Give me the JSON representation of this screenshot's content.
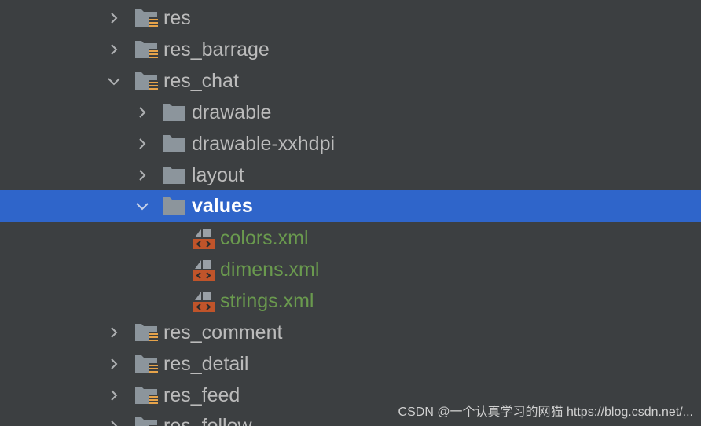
{
  "tree": {
    "items": [
      {
        "label": "res",
        "expanded": false,
        "type": "resource-folder"
      },
      {
        "label": "res_barrage",
        "expanded": false,
        "type": "resource-folder"
      },
      {
        "label": "res_chat",
        "expanded": true,
        "type": "resource-folder"
      },
      {
        "label": "drawable",
        "expanded": false,
        "type": "folder"
      },
      {
        "label": "drawable-xxhdpi",
        "expanded": false,
        "type": "folder"
      },
      {
        "label": "layout",
        "expanded": false,
        "type": "folder"
      },
      {
        "label": "values",
        "expanded": true,
        "type": "folder",
        "selected": true
      },
      {
        "label": "colors.xml",
        "type": "xml-file"
      },
      {
        "label": "dimens.xml",
        "type": "xml-file"
      },
      {
        "label": "strings.xml",
        "type": "xml-file"
      },
      {
        "label": "res_comment",
        "expanded": false,
        "type": "resource-folder"
      },
      {
        "label": "res_detail",
        "expanded": false,
        "type": "resource-folder"
      },
      {
        "label": "res_feed",
        "expanded": false,
        "type": "resource-folder"
      },
      {
        "label": "res_follow",
        "expanded": false,
        "type": "resource-folder"
      }
    ]
  },
  "watermark": "CSDN @一个认真学习的网猫 https://blog.csdn.net/..."
}
